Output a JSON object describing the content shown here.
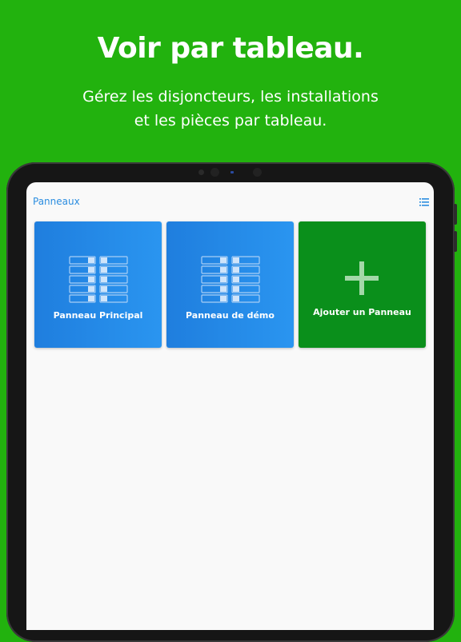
{
  "promo": {
    "headline": "Voir par tableau.",
    "subline_1": "Gérez les disjoncteurs, les installations",
    "subline_2": "et les pièces par tableau."
  },
  "navbar": {
    "title": "Panneaux",
    "menu_icon": "list-icon"
  },
  "tiles": [
    {
      "label": "Panneau Principal",
      "icon": "breaker-panel-icon",
      "color": "#1f7ede"
    },
    {
      "label": "Panneau de démo",
      "icon": "breaker-panel-icon",
      "color": "#1f7ede"
    },
    {
      "label": "Ajouter un Panneau",
      "icon": "plus-icon",
      "color": "#0a8f1b"
    }
  ],
  "colors": {
    "background": "#22b20e",
    "accent_blue": "#2b8de0",
    "tile_blue": "#1f7ede",
    "tile_green": "#0a8f1b"
  }
}
